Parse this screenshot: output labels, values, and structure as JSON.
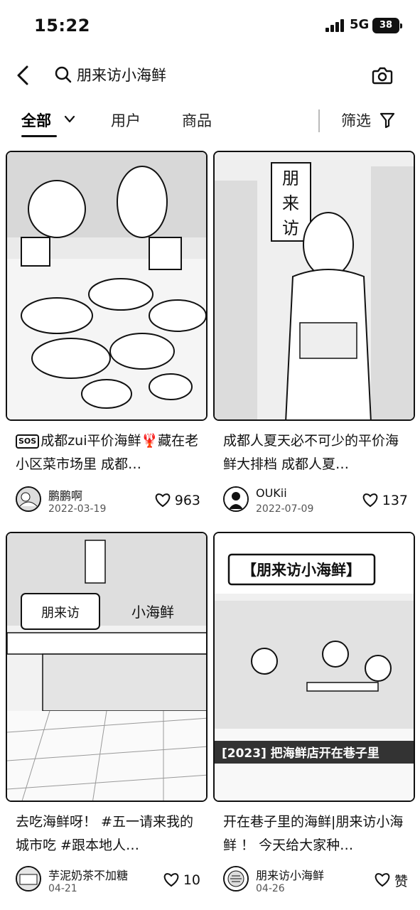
{
  "status_bar": {
    "time": "15:22",
    "network": "5G",
    "battery": "38"
  },
  "search": {
    "query": "朋来访小海鲜"
  },
  "tabs": [
    {
      "label": "全部"
    },
    {
      "label": "用户"
    },
    {
      "label": "商品"
    }
  ],
  "filter": {
    "label": "筛选"
  },
  "cards": [
    {
      "badge": "SOS",
      "title": "成都zui平价海鲜🦞藏在老小区菜市场里 成都…",
      "author": "鹏鹏啊",
      "date": "2022-03-19",
      "likes": "963"
    },
    {
      "title": "成都人夏天必不可少的平价海鲜大排档 成都人夏…",
      "author": "OUKii",
      "date": "2022-07-09",
      "likes": "137",
      "image_sign": [
        "朋",
        "来",
        "访"
      ]
    },
    {
      "title": "去吃海鲜呀！ #五一请来我的城市吃 #跟本地人…",
      "author": "芋泥奶茶不加糖",
      "date": "04-21",
      "likes": "10",
      "image_sign": [
        "朋来访",
        "小海鲜"
      ]
    },
    {
      "title": "开在巷子里的海鲜|朋来访小海鲜 ！ 今天给大家种…",
      "author": "朋来访小海鲜",
      "date": "04-26",
      "likes": "赞",
      "image_banner": "【朋来访小海鲜】",
      "image_caption": "[2023] 把海鲜店开在巷子里"
    }
  ]
}
